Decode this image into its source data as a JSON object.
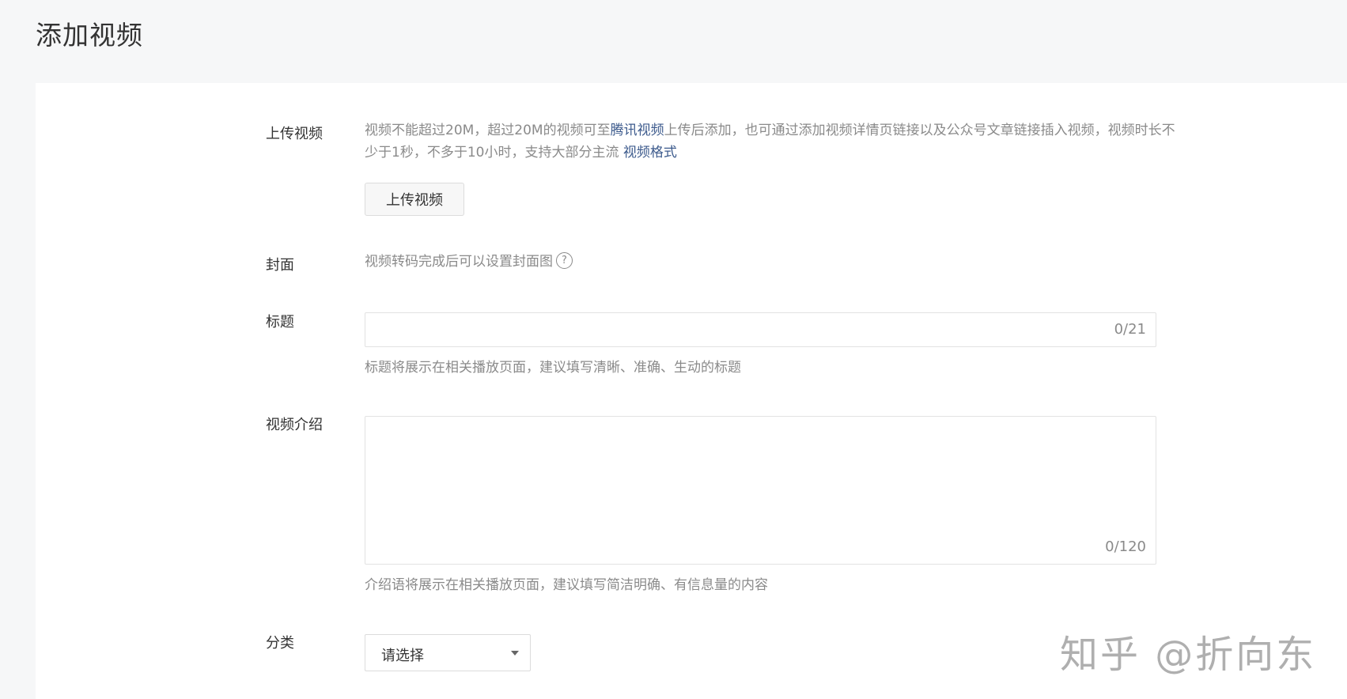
{
  "page": {
    "title": "添加视频"
  },
  "upload": {
    "label": "上传视频",
    "desc_part1": "视频不能超过20M，超过20M的视频可至",
    "desc_link1": "腾讯视频",
    "desc_part2": "上传后添加，也可通过添加视频详情页链接以及公众号文章链接插入视频，视频时长不少于1秒，不多于10小时，支持大部分主流 ",
    "desc_link2": "视频格式",
    "button_label": "上传视频"
  },
  "cover": {
    "label": "封面",
    "hint": "视频转码完成后可以设置封面图",
    "help_icon": "?"
  },
  "title_field": {
    "label": "标题",
    "value": "",
    "counter": "0/21",
    "hint": "标题将展示在相关播放页面，建议填写清晰、准确、生动的标题"
  },
  "intro_field": {
    "label": "视频介绍",
    "value": "",
    "counter": "0/120",
    "hint": "介绍语将展示在相关播放页面，建议填写简洁明确、有信息量的内容"
  },
  "category": {
    "label": "分类",
    "selected": "请选择"
  },
  "watermark": {
    "text": "知乎 @折向东"
  }
}
